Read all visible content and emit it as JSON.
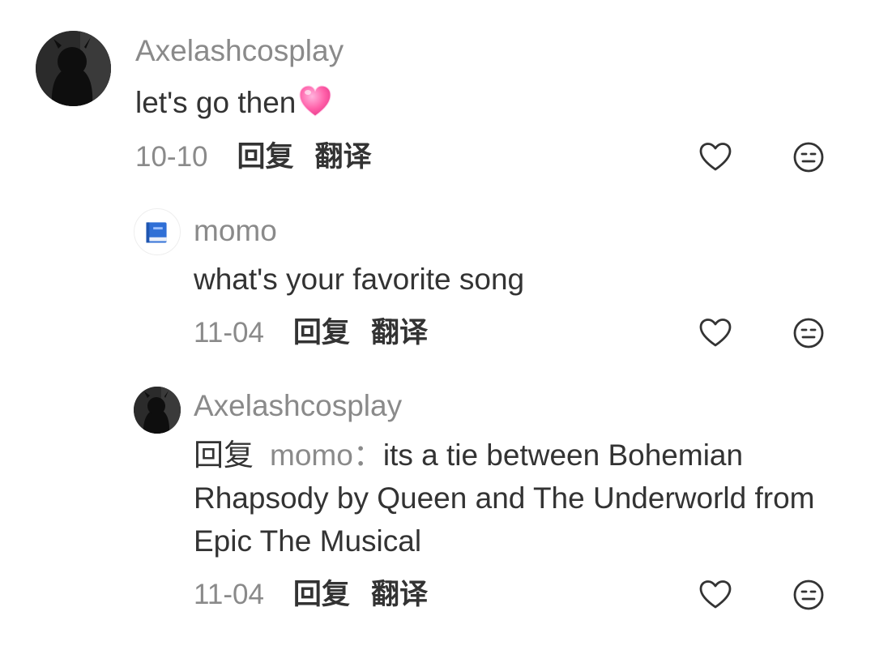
{
  "comments": [
    {
      "username": "Axelashcosplay",
      "text": "let's go then",
      "emoji": "pink-heart",
      "date": "10-10",
      "reply": "回复",
      "translate": "翻译"
    },
    {
      "username": "momo",
      "text": "what's your favorite song",
      "date": "11-04",
      "reply": "回复",
      "translate": "翻译"
    },
    {
      "username": "Axelashcosplay",
      "reply_prefix": "回复",
      "mention": "momo",
      "separator": "：",
      "text": "its a tie between Bohemian Rhapsody by Queen and The Underworld from Epic The Musical",
      "date": "11-04",
      "reply": "回复",
      "translate": "翻译"
    }
  ],
  "icons": {
    "like": "heart-outline-icon",
    "dislike": "meh-face-icon"
  },
  "colors": {
    "primary_text": "#333333",
    "secondary_text": "#8a8a8a",
    "heart_emoji": "#ff5fa8"
  }
}
